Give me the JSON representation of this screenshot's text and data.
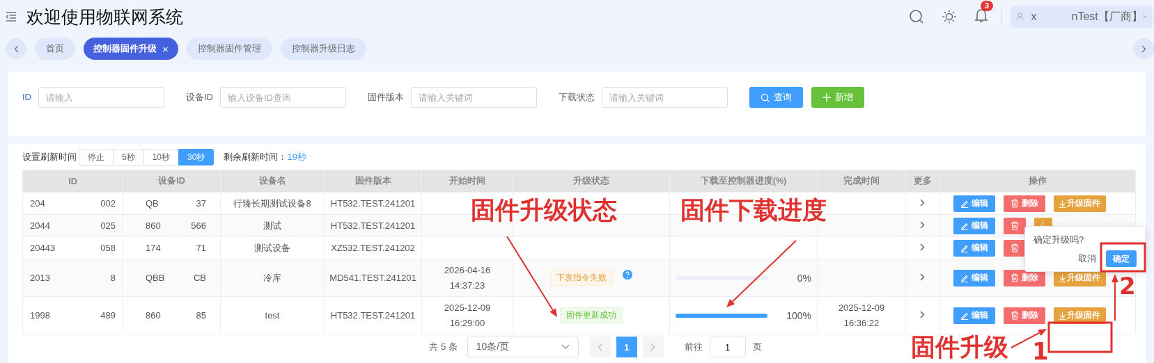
{
  "header": {
    "title": "欢迎使用物联网系统",
    "notification_count": "3",
    "user": [
      "x",
      "nTest【厂商】"
    ]
  },
  "tabs": [
    {
      "label": "首页",
      "selected": false
    },
    {
      "label": "控制器固件升级",
      "selected": true,
      "close": "×"
    },
    {
      "label": "控制器固件管理",
      "selected": false
    },
    {
      "label": "控制器升级日志",
      "selected": false
    }
  ],
  "filters": [
    {
      "label": "ID",
      "placeholder": "请输入"
    },
    {
      "label": "设备ID",
      "placeholder": "输入设备ID查询"
    },
    {
      "label": "固件版本",
      "placeholder": "请输入关键词"
    },
    {
      "label": "下载状态",
      "placeholder": "请输入关键词"
    }
  ],
  "filter_buttons": [
    {
      "kind": "search",
      "label": "查询"
    },
    {
      "kind": "add",
      "label": "新增"
    }
  ],
  "refresh": {
    "label": "设置刷新时间",
    "options": [
      {
        "label": "停止",
        "selected": false
      },
      {
        "label": "5秒",
        "selected": false
      },
      {
        "label": "10秒",
        "selected": false
      },
      {
        "label": "30秒",
        "selected": true
      }
    ],
    "remaining_label": "剩余刷新时间：",
    "remaining": "19秒"
  },
  "table": {
    "columns": [
      "ID",
      "设备ID",
      "设备名",
      "固件版本",
      "开始时间",
      "升级状态",
      "下载至控制器进度(%)",
      "完成时间",
      "更多",
      "操作"
    ],
    "rows": [
      {
        "id": [
          "204",
          "002"
        ],
        "device_id": [
          "QB",
          "37"
        ],
        "name": "行臻长期测试设备8",
        "version": "HT532.TEST.241201",
        "actions": [
          {
            "kind": "edit",
            "label": "编辑"
          },
          {
            "kind": "delete",
            "label": "删除"
          },
          {
            "kind": "upgrade",
            "label": "升级固件"
          }
        ]
      },
      {
        "id": [
          "2044",
          "025"
        ],
        "device_id": [
          "860",
          "566"
        ],
        "name": "测试",
        "version": "HT532.TEST.241201",
        "actions": [
          {
            "kind": "edit",
            "label": "编辑"
          },
          {
            "kind": "delete"
          },
          {
            "kind": "upgrade"
          }
        ]
      },
      {
        "id": [
          "20443",
          "058"
        ],
        "device_id": [
          "174",
          "71"
        ],
        "name": "测试设备",
        "version": "XZ532.TEST.241202",
        "actions": [
          {
            "kind": "edit",
            "label": "编辑"
          },
          {
            "kind": "delete"
          }
        ]
      },
      {
        "id": [
          "2013",
          "8"
        ],
        "device_id": [
          "QBB",
          "CB"
        ],
        "name": "冷库",
        "version": "MD541.TEST.241201",
        "start": "2026-04-16\n14:37:23",
        "status": {
          "kind": "warning",
          "text": "下发指令失败",
          "help": true
        },
        "progress": {
          "level": 0,
          "reading": "0%"
        },
        "actions": [
          {
            "kind": "edit",
            "label": "编辑"
          },
          {
            "kind": "delete",
            "label": "删除"
          },
          {
            "kind": "upgrade",
            "label": "升级固件"
          }
        ]
      },
      {
        "id": [
          "1998",
          "489"
        ],
        "device_id": [
          "860",
          "85"
        ],
        "name": "test",
        "version": "HT532.TEST.241201",
        "start": "2025-12-09\n16:29:00",
        "status": {
          "kind": "success",
          "text": "固件更新成功",
          "help": false
        },
        "progress": {
          "level": 1,
          "reading": "100%"
        },
        "end": "2025-12-09\n16:36:22",
        "actions": [
          {
            "kind": "edit",
            "label": "编辑"
          },
          {
            "kind": "delete",
            "label": "删除"
          },
          {
            "kind": "upgrade",
            "label": "升级固件"
          }
        ]
      }
    ]
  },
  "pagination": {
    "total": "共 5 条",
    "page_size": "10条/页",
    "pages": [
      {
        "label": "1",
        "selected": true
      }
    ],
    "goto_label": "前往",
    "goto_value": "1",
    "goto_suffix": "页"
  },
  "popover": {
    "message": "确定升级吗?",
    "cancel": "取消",
    "confirm": "确定"
  },
  "annotations": [
    {
      "kind": "label",
      "text": "固件升级状态"
    },
    {
      "kind": "label",
      "text": "固件下载进度"
    },
    {
      "kind": "label",
      "text": "固件升级"
    },
    {
      "kind": "step",
      "text": "1"
    },
    {
      "kind": "step",
      "text": "2"
    }
  ]
}
